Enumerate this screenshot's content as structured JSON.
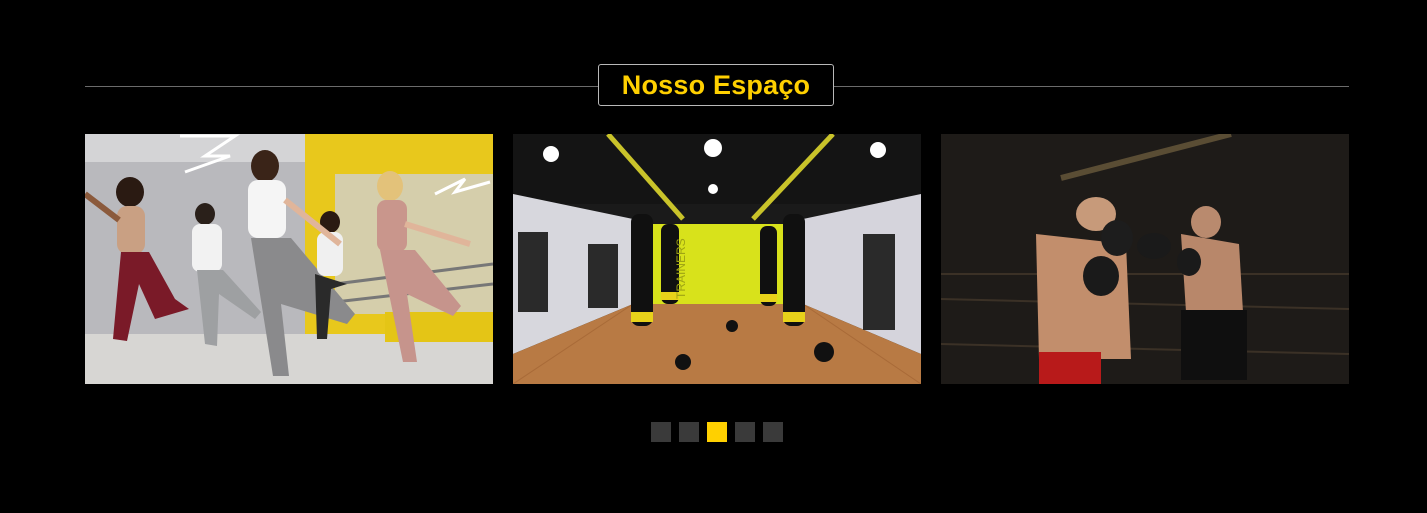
{
  "section": {
    "title": "Nosso Espaço"
  },
  "slides": [
    {
      "alt": "dance-class-photo"
    },
    {
      "alt": "boxing-gym-photo",
      "wall_text": "TRAINERS"
    },
    {
      "alt": "sparring-photo"
    }
  ],
  "pagination": {
    "count": 5,
    "active_index": 2
  },
  "colors": {
    "background": "#000000",
    "accent": "#ffd000",
    "dot_inactive": "#3a3a3a"
  }
}
